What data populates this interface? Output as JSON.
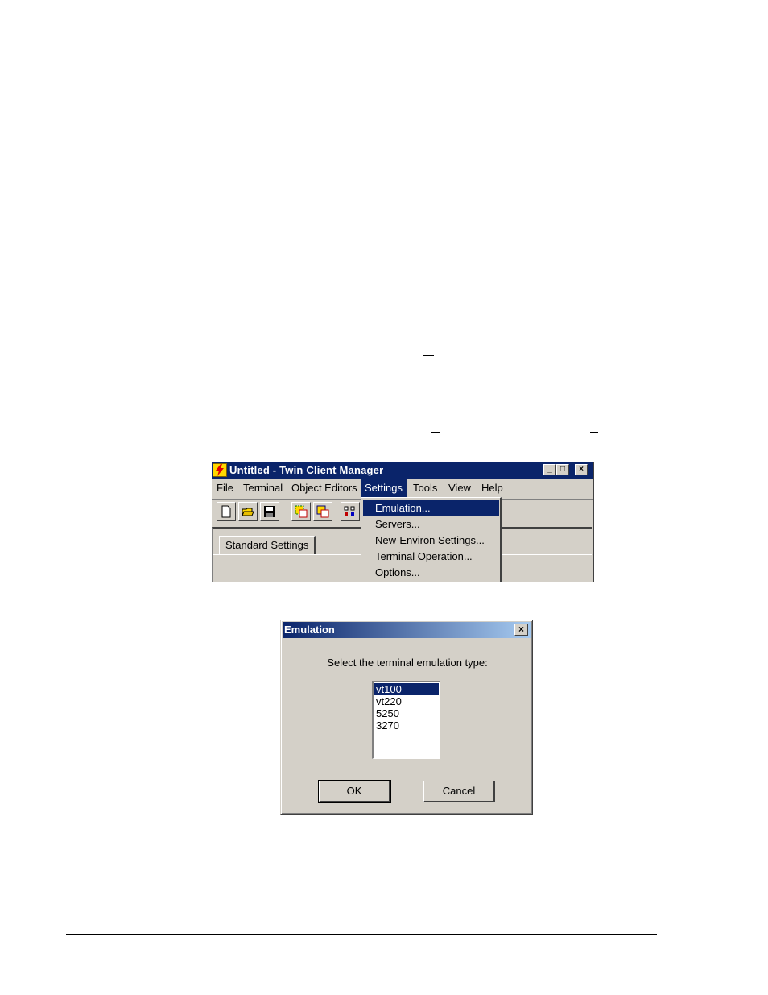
{
  "app_window": {
    "title": "Untitled - Twin Client Manager",
    "menu": [
      "File",
      "Terminal",
      "Object Editors",
      "Settings",
      "Tools",
      "View",
      "Help"
    ],
    "active_menu": "Settings",
    "toolbar_icons": [
      "new-document-icon",
      "open-folder-icon",
      "save-icon",
      "object-editor-icon",
      "object-editor-alt-icon",
      "layout-icon"
    ],
    "tab_label": "Standard Settings",
    "settings_menu_items": [
      "Emulation...",
      "Servers...",
      "New-Environ Settings...",
      "Terminal Operation...",
      "Options..."
    ],
    "highlighted_item": "Emulation..."
  },
  "emulation_dialog": {
    "title": "Emulation",
    "prompt": "Select the terminal emulation type:",
    "options": [
      "vt100",
      "vt220",
      "5250",
      "3270"
    ],
    "selected": "vt100",
    "ok_label": "OK",
    "cancel_label": "Cancel"
  },
  "colors": {
    "title_bar": "#0a246a",
    "face": "#d4d0c8",
    "selection": "#0a246a"
  }
}
